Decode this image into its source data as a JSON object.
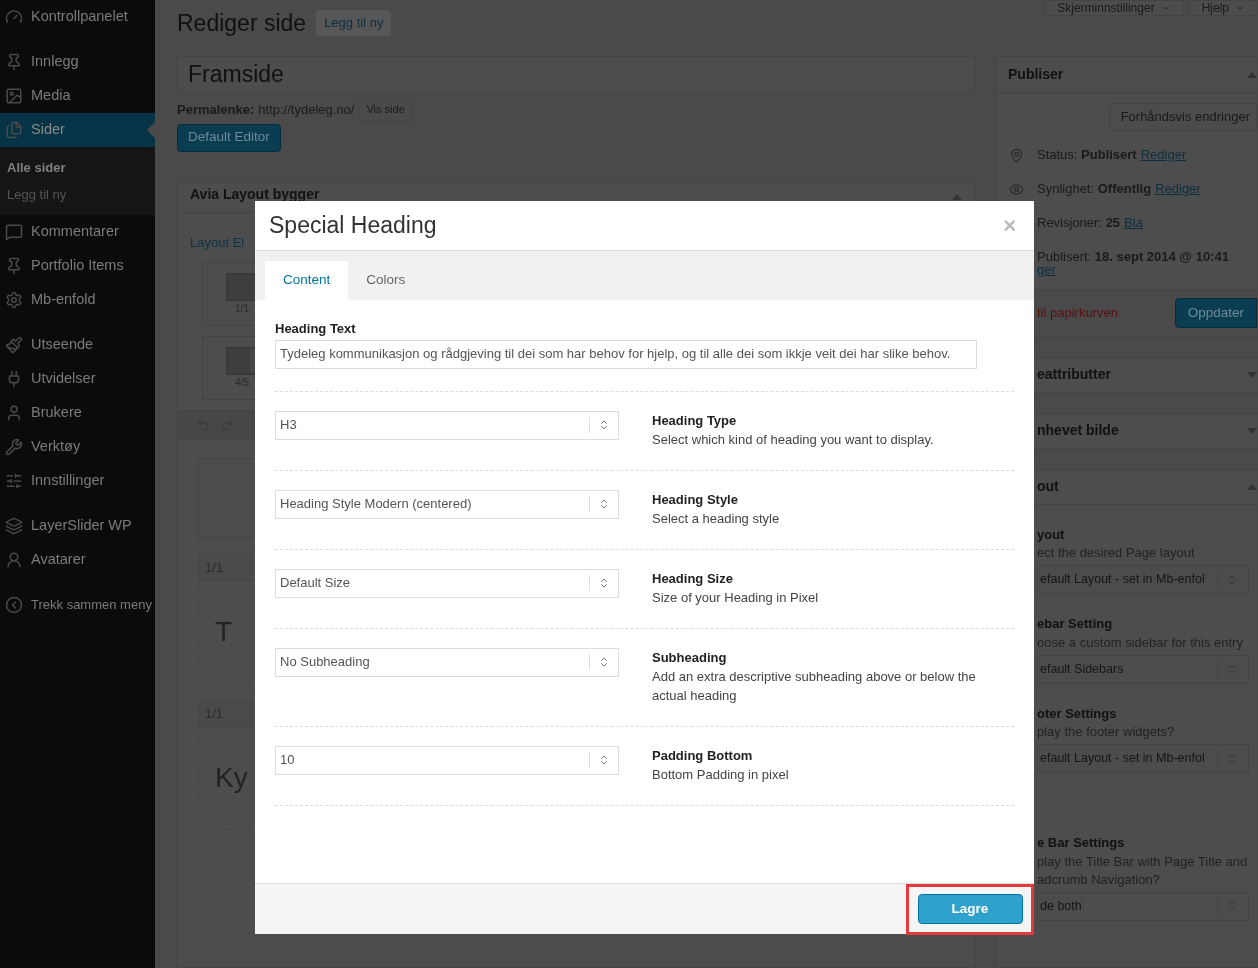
{
  "sidebar": {
    "groups": [
      [
        {
          "label": "Kontrollpanelet",
          "selected": false
        }
      ],
      [
        {
          "label": "Innlegg",
          "selected": false
        },
        {
          "label": "Media",
          "selected": false
        },
        {
          "label": "Sider",
          "selected": true,
          "submenu": [
            {
              "label": "Alle sider",
              "selected": true
            },
            {
              "label": "Legg til ny",
              "selected": false
            }
          ]
        },
        {
          "label": "Kommentarer",
          "selected": false
        },
        {
          "label": "Portfolio Items",
          "selected": false
        },
        {
          "label": "Mb-enfold",
          "selected": false
        }
      ],
      [
        {
          "label": "Utseende",
          "selected": false
        },
        {
          "label": "Utvidelser",
          "selected": false
        },
        {
          "label": "Brukere",
          "selected": false
        },
        {
          "label": "Verktøy",
          "selected": false
        },
        {
          "label": "Innstillinger",
          "selected": false
        }
      ],
      [
        {
          "label": "LayerSlider WP",
          "selected": false
        },
        {
          "label": "Avatarer",
          "selected": false
        }
      ],
      [
        {
          "label": "Trekk sammen meny",
          "selected": false
        }
      ]
    ]
  },
  "top_buttons": [
    "Skjerminnstillinger",
    "Hjelp"
  ],
  "page": {
    "title": "Rediger side",
    "add_new": "Legg til ny",
    "post_title": "Framside",
    "permalink_label": "Permalenke:",
    "permalink": "http://tydeleg.no/",
    "view_button": "Vis side",
    "editor_button": "Default Editor"
  },
  "builder": {
    "title": "Avia Layout bygger",
    "tab": "Layout El",
    "layouts": [
      "1/1",
      "4/5"
    ],
    "blocks": [
      {
        "label": "1/1",
        "text": "T"
      },
      {
        "label": "1/1",
        "text": "Ky"
      }
    ]
  },
  "publish": {
    "title": "Publiser",
    "preview_button": "Forhåndsvis endringer",
    "rows": [
      {
        "text": "Status: **Publisert**",
        "link": "Rediger"
      },
      {
        "text": "Synlighet: **Offentlig**",
        "link": "Rediger"
      },
      {
        "text": "Revisjoner: **25**",
        "link": "Bla"
      },
      {
        "text": "Publisert: **18. sept 2014 @ 10:41**"
      }
    ],
    "cut_link": "ger",
    "trash": "til papirkurven",
    "update_button": "Oppdater"
  },
  "side_panels": [
    "eattributter",
    "nhevet bilde",
    "out"
  ],
  "layout_settings": [
    {
      "title": "yout",
      "description": "ect the desired Page layout",
      "value": "efault Layout - set in Mb-enfol"
    },
    {
      "title": "ebar Setting",
      "description": "oose a custom sidebar for this entry",
      "value": "efault Sidebars"
    },
    {
      "title": "oter Settings",
      "description": "play the footer widgets?",
      "value": "efault Layout - set in Mb-enfol"
    },
    {
      "title": "e Bar Settings",
      "description": "play the Title Bar with Page Title and adcrumb Navigation?",
      "value": "de both"
    }
  ],
  "modal": {
    "title": "Special Heading",
    "close": "×",
    "tabs": [
      {
        "label": "Content",
        "selected": true
      },
      {
        "label": "Colors",
        "selected": false
      }
    ],
    "fields": [
      {
        "kind": "text",
        "label": "Heading Text",
        "value": "Tydeleg kommunikasjon og rådgjeving til dei som har behov for hjelp, og til alle dei som ikkje veit dei har slike behov."
      },
      {
        "kind": "select",
        "label": "Heading Type",
        "description": "Select which kind of heading you want to display.",
        "value": "H3"
      },
      {
        "kind": "select",
        "label": "Heading Style",
        "description": "Select a heading style",
        "value": "Heading Style Modern (centered)"
      },
      {
        "kind": "select",
        "label": "Heading Size",
        "description": "Size of your Heading in Pixel",
        "value": "Default Size"
      },
      {
        "kind": "select",
        "label": "Subheading",
        "description": "Add an extra descriptive subheading above or below the actual heading",
        "value": "No Subheading"
      },
      {
        "kind": "select",
        "label": "Padding Bottom",
        "description": "Bottom Padding in pixel",
        "value": "10"
      }
    ],
    "save_button": "Lagre",
    "save_highlighted": true
  }
}
